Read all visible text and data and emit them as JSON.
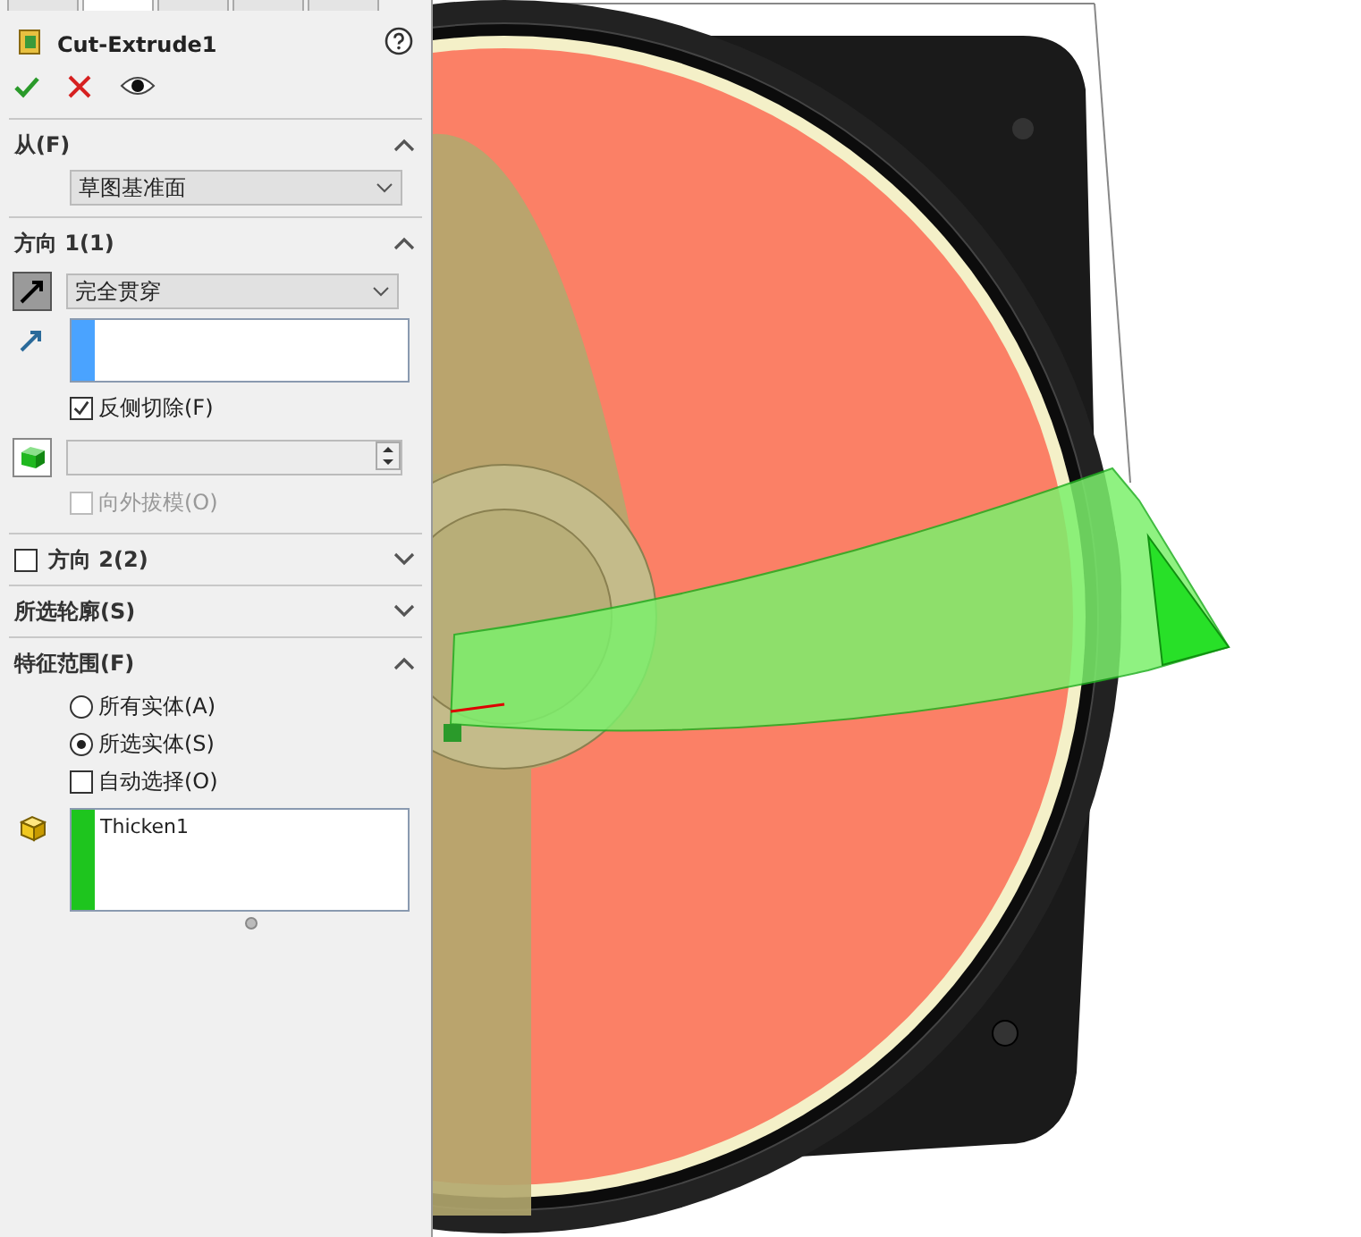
{
  "tabs": [
    {
      "selected": false
    },
    {
      "selected": true
    },
    {
      "selected": false
    },
    {
      "selected": false
    },
    {
      "selected": false
    }
  ],
  "feature": {
    "title": "Cut-Extrude1"
  },
  "sections": [
    {
      "kind": "from",
      "title": "从(F)",
      "expanded": true,
      "dropdown": "草图基准面"
    },
    {
      "kind": "direction1",
      "title": "方向 1(1)",
      "expanded": true,
      "dropdown": "完全贯穿",
      "reverse": {
        "label": "反侧切除(F)",
        "checked": true
      },
      "spinner": {
        "disabled": true
      },
      "draft": {
        "label": "向外拔模(O)",
        "checked": false,
        "disabled": true
      }
    },
    {
      "kind": "direction2",
      "title": "方向 2(2)",
      "expanded": false,
      "checked": false
    },
    {
      "kind": "profiles",
      "title": "所选轮廓(S)",
      "expanded": false
    },
    {
      "kind": "scope",
      "title": "特征范围(F)",
      "expanded": true,
      "options": [
        {
          "label": "所有实体(A)",
          "selected": false
        },
        {
          "label": "所选实体(S)",
          "selected": true
        }
      ],
      "auto_select": {
        "label": "自动选择(O)",
        "checked": false
      },
      "bodies": [
        "Thicken1"
      ]
    }
  ]
}
